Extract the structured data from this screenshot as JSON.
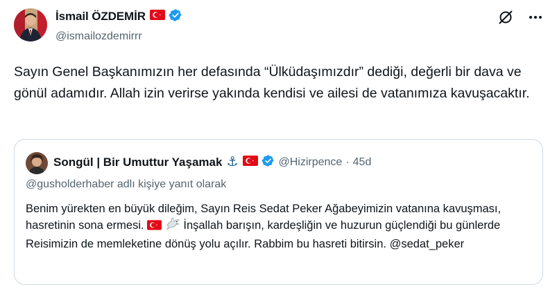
{
  "author": {
    "display_name": "İsmail ÖZDEMİR",
    "handle": "@ismailozdemirrr",
    "flag_icon": "turkey-flag-icon",
    "verified_icon": "verified-badge-icon"
  },
  "header_actions": {
    "grok_icon": "grok-icon",
    "more_icon": "more-options-icon"
  },
  "tweet": {
    "text": "Sayın Genel Başkanımızın her defasında “Ülküdaşımızdır” dediği, değerli bir dava ve gönül adamıdır. Allah izin verirse yakında kendisi ve ailesi de vatanımıza kavuşacaktır."
  },
  "quote": {
    "display_name": "Songül | Bir Umuttur Yaşamak",
    "handle": "@Hizirpence",
    "separator": "·",
    "time": "45d",
    "reply_to": "@gusholderhaber adlı kişiye yanıt olarak",
    "text_part1": "Benim yürekten en büyük dileğim, Sayın Reis Sedat Peker Ağabeyimizin vatanına kavuşması, hasretinin sona ermesi.",
    "text_part2": "İnşallah barışın, kardeşliğin ve huzurun güçlendiği bu günlerde Reisimizin de memleketine dönüş yolu açılır. Rabbim bu hasreti bitirsin.",
    "mention": "@sedat_peker",
    "anchor_emoji": "⚓"
  },
  "colors": {
    "text": "#0f1419",
    "secondary": "#536471",
    "border": "#cfd9de",
    "verified": "#1d9bf0",
    "flag_red": "#e30a17"
  }
}
